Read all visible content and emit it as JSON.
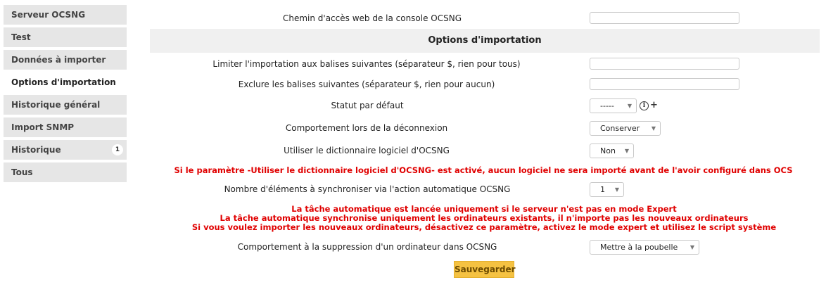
{
  "sidebar": {
    "tabs": [
      {
        "label": "Serveur OCSNG"
      },
      {
        "label": "Test"
      },
      {
        "label": "Données à importer"
      },
      {
        "label": "Options d'importation"
      },
      {
        "label": "Historique général"
      },
      {
        "label": "Import SNMP"
      },
      {
        "label": "Historique",
        "badge": "1"
      },
      {
        "label": "Tous"
      }
    ],
    "active_index": 3
  },
  "form": {
    "web_path_label": "Chemin d'accès web de la console OCSNG",
    "web_path_value": "",
    "section_title": "Options d'importation",
    "limit_tags_label": "Limiter l'importation aux balises suivantes (séparateur $, rien pour tous)",
    "limit_tags_value": "",
    "exclude_tags_label": "Exclure les balises suivantes (séparateur $, rien pour aucun)",
    "exclude_tags_value": "",
    "default_status_label": "Statut par défaut",
    "default_status_value": "-----",
    "disconnect_label": "Comportement lors de la déconnexion",
    "disconnect_value": "Conserver",
    "dictionary_label": "Utiliser le dictionnaire logiciel d'OCSNG",
    "dictionary_value": "Non",
    "dictionary_warning": "Si le paramètre -Utiliser le dictionnaire logiciel d'OCSNG- est activé, aucun logiciel ne sera importé avant de l'avoir configuré dans OCS",
    "sync_count_label": "Nombre d'éléments à synchroniser via l'action automatique OCSNG",
    "sync_count_value": "1",
    "auto_warning_1": "La tâche automatique est lancée uniquement si le serveur n'est pas en mode Expert",
    "auto_warning_2": "La tâche automatique synchronise uniquement les ordinateurs existants, il n'importe pas les nouveaux ordinateurs",
    "auto_warning_3": "Si vous voulez importer les nouveaux ordinateurs, désactivez ce paramètre, activez le mode expert et utilisez le script système",
    "delete_label": "Comportement à la suppression d'un ordinateur dans OCSNG",
    "delete_value": "Mettre à la poubelle",
    "save_label": "Sauvegarder"
  },
  "icons": {
    "info": "info-icon",
    "add": "plus-icon",
    "dropdown": "chevron-down-icon"
  },
  "colors": {
    "warning": "#e00000",
    "save_button": "#f5c242",
    "section_header_bg": "#f0f0f0",
    "tab_bg": "#e6e6e6"
  }
}
